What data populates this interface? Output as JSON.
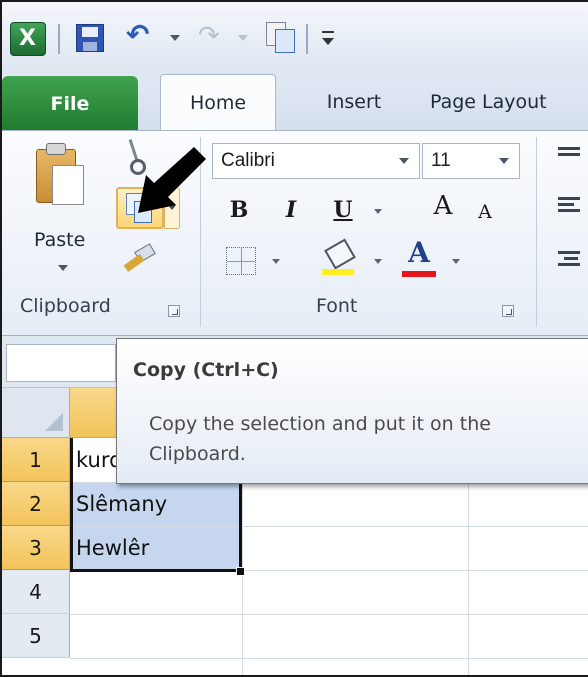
{
  "tabs": {
    "file": "File",
    "home": "Home",
    "insert": "Insert",
    "page_layout": "Page Layout"
  },
  "ribbon": {
    "clipboard": {
      "paste_label": "Paste",
      "group_label": "Clipboard"
    },
    "font": {
      "font_name": "Calibri",
      "font_size": "11",
      "bold": "B",
      "italic": "I",
      "underline": "U",
      "grow_font": "A",
      "shrink_font": "A",
      "font_color_glyph": "A",
      "group_label": "Font"
    }
  },
  "tooltip": {
    "title": "Copy (Ctrl+C)",
    "body": "Copy the selection and put it on the Clipboard."
  },
  "sheet": {
    "row_headers": [
      "1",
      "2",
      "3",
      "4",
      "5"
    ],
    "cells": [
      "kurdistan",
      "Slêmany",
      "Hewlêr"
    ]
  },
  "colors": {
    "file_tab": "#2a8a3c",
    "selection_fill": "#c5d6ee",
    "header_highlight": "#f6cd6c",
    "font_color_bar": "#e3161d",
    "fill_color_bar": "#ffee22"
  },
  "icons": [
    "excel-icon",
    "save-icon",
    "undo-icon",
    "redo-icon",
    "copy-icon",
    "cut-icon",
    "paste-icon",
    "format-painter-icon",
    "border-icon",
    "fill-color-icon",
    "font-color-icon",
    "arrow-pointer-icon"
  ]
}
